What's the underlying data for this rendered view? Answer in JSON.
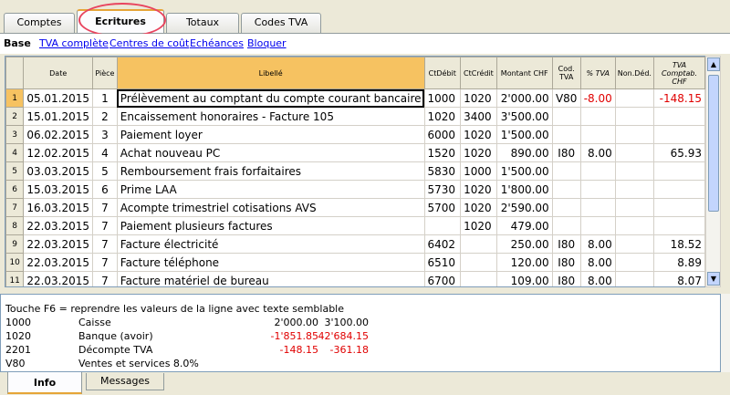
{
  "tabs": [
    "Comptes",
    "Ecritures",
    "Totaux",
    "Codes TVA"
  ],
  "subnav": {
    "base": "Base",
    "links": [
      "TVA complète",
      "Centres de coût",
      "Echéances",
      "Bloquer"
    ]
  },
  "columns": [
    "",
    "Date",
    "Pièce",
    "Libellé",
    "CtDébit",
    "CtCrédit",
    "Montant CHF",
    "Cod. TVA",
    "% TVA",
    "Non.Déd.",
    "TVA Comptab. CHF"
  ],
  "rows": [
    {
      "n": "1",
      "date": "05.01.2015",
      "piece": "1",
      "libelle": "Prélèvement au comptant du compte courant bancaire",
      "debit": "1000",
      "credit": "1020",
      "montant": "2'000.00",
      "cod": "V80",
      "pct": "-8.00",
      "nonded": "",
      "tva": "-148.15"
    },
    {
      "n": "2",
      "date": "15.01.2015",
      "piece": "2",
      "libelle": "Encaissement honoraires - Facture 105",
      "debit": "1020",
      "credit": "3400",
      "montant": "3'500.00",
      "cod": "",
      "pct": "",
      "nonded": "",
      "tva": ""
    },
    {
      "n": "3",
      "date": "06.02.2015",
      "piece": "3",
      "libelle": "Paiement loyer",
      "debit": "6000",
      "credit": "1020",
      "montant": "1'500.00",
      "cod": "",
      "pct": "",
      "nonded": "",
      "tva": ""
    },
    {
      "n": "4",
      "date": "12.02.2015",
      "piece": "4",
      "libelle": "Achat nouveau PC",
      "debit": "1520",
      "credit": "1020",
      "montant": "890.00",
      "cod": "I80",
      "pct": "8.00",
      "nonded": "",
      "tva": "65.93"
    },
    {
      "n": "5",
      "date": "03.03.2015",
      "piece": "5",
      "libelle": "Remboursement frais forfaitaires",
      "debit": "5830",
      "credit": "1000",
      "montant": "1'500.00",
      "cod": "",
      "pct": "",
      "nonded": "",
      "tva": ""
    },
    {
      "n": "6",
      "date": "15.03.2015",
      "piece": "6",
      "libelle": "Prime LAA",
      "debit": "5730",
      "credit": "1020",
      "montant": "1'800.00",
      "cod": "",
      "pct": "",
      "nonded": "",
      "tva": ""
    },
    {
      "n": "7",
      "date": "16.03.2015",
      "piece": "7",
      "libelle": "Acompte trimestriel cotisations AVS",
      "debit": "5700",
      "credit": "1020",
      "montant": "2'590.00",
      "cod": "",
      "pct": "",
      "nonded": "",
      "tva": ""
    },
    {
      "n": "8",
      "date": "22.03.2015",
      "piece": "7",
      "libelle": "Paiement plusieurs factures",
      "debit": "",
      "credit": "1020",
      "montant": "479.00",
      "cod": "",
      "pct": "",
      "nonded": "",
      "tva": ""
    },
    {
      "n": "9",
      "date": "22.03.2015",
      "piece": "7",
      "libelle": "Facture électricité",
      "debit": "6402",
      "credit": "",
      "montant": "250.00",
      "cod": "I80",
      "pct": "8.00",
      "nonded": "",
      "tva": "18.52"
    },
    {
      "n": "10",
      "date": "22.03.2015",
      "piece": "7",
      "libelle": "Facture téléphone",
      "debit": "6510",
      "credit": "",
      "montant": "120.00",
      "cod": "I80",
      "pct": "8.00",
      "nonded": "",
      "tva": "8.89"
    },
    {
      "n": "11",
      "date": "22.03.2015",
      "piece": "7",
      "libelle": "Facture matériel de bureau",
      "debit": "6700",
      "credit": "",
      "montant": "109.00",
      "cod": "I80",
      "pct": "8.00",
      "nonded": "",
      "tva": "8.07"
    }
  ],
  "info": {
    "hint": "Touche F6 = reprendre les valeurs de la ligne avec texte semblable",
    "lines": [
      {
        "acc": "1000",
        "desc": "Caisse",
        "v1": "2'000.00",
        "v2": "3'100.00",
        "neg": false
      },
      {
        "acc": "1020",
        "desc": "Banque (avoir)",
        "v1": "-1'851.85",
        "v2": "42'684.15",
        "neg": true
      },
      {
        "acc": "2201",
        "desc": "Décompte TVA",
        "v1": "-148.15",
        "v2": "-361.18",
        "neg": true
      },
      {
        "acc": "V80",
        "desc": "Ventes et services 8.0%",
        "v1": "",
        "v2": "",
        "neg": false
      }
    ]
  },
  "bottom_tabs": [
    "Info",
    "Messages"
  ],
  "colors": {
    "highlight": "#f6c261",
    "negative": "#e00000",
    "link": "#0000ee"
  }
}
